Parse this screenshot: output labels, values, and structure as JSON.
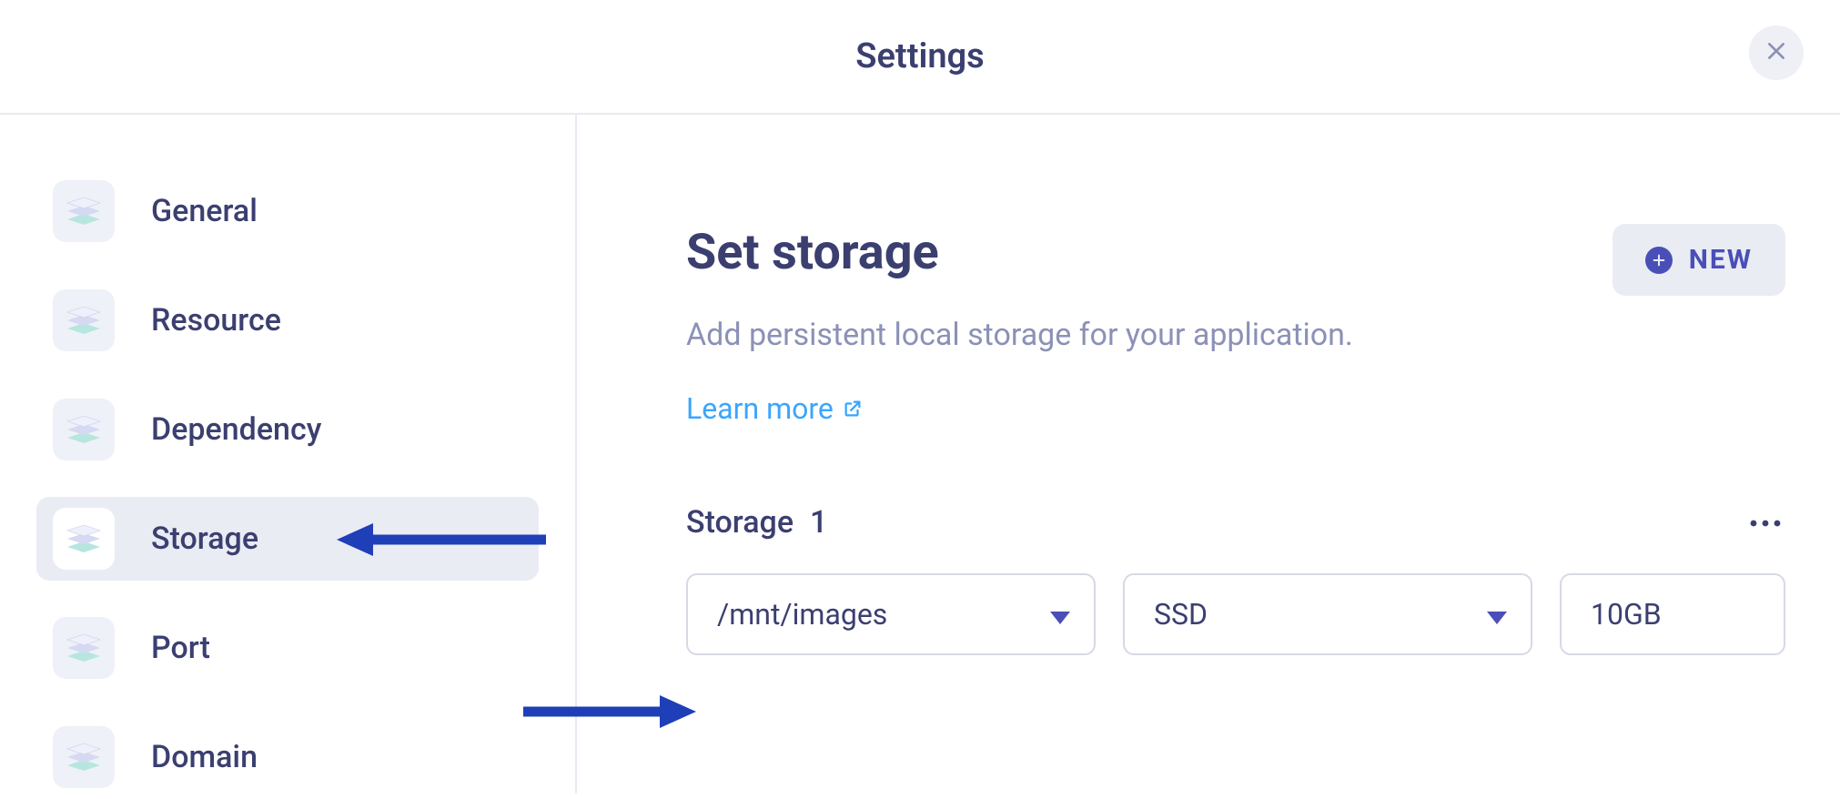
{
  "header": {
    "title": "Settings"
  },
  "sidebar": {
    "items": [
      {
        "label": "General",
        "active": false
      },
      {
        "label": "Resource",
        "active": false
      },
      {
        "label": "Dependency",
        "active": false
      },
      {
        "label": "Storage",
        "active": true
      },
      {
        "label": "Port",
        "active": false
      },
      {
        "label": "Domain",
        "active": false
      }
    ]
  },
  "main": {
    "heading": "Set storage",
    "subheading": "Add persistent local storage for your application.",
    "learn_more_label": "Learn more",
    "new_button_label": "NEW",
    "storage_section": {
      "title_prefix": "Storage",
      "index": "1",
      "path_value": "/mnt/images",
      "type_value": "SSD",
      "size_value": "10GB"
    }
  }
}
